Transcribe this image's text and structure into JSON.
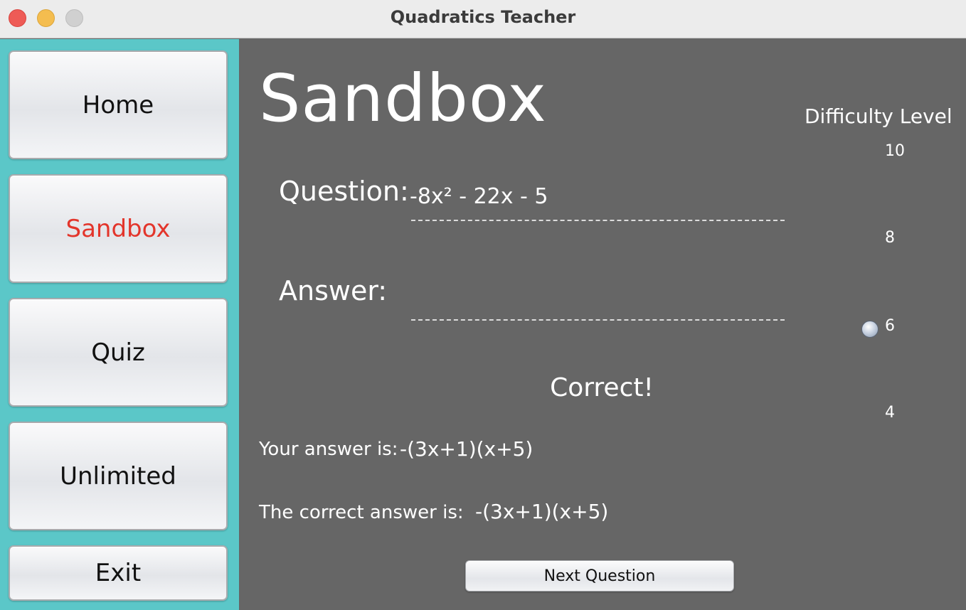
{
  "window": {
    "title": "Quadratics Teacher"
  },
  "sidebar": {
    "items": [
      {
        "label": "Home",
        "active": false
      },
      {
        "label": "Sandbox",
        "active": true
      },
      {
        "label": "Quiz",
        "active": false
      },
      {
        "label": "Unlimited",
        "active": false
      },
      {
        "label": "Exit",
        "active": false
      }
    ],
    "active_color": "#e3352b",
    "background": "#5bc7c8"
  },
  "main": {
    "page_title": "Sandbox",
    "question_label": "Question:",
    "question_text": "-8x² - 22x - 5",
    "answer_label": "Answer:",
    "answer_value": "",
    "result": "Correct!",
    "your_answer_label": "Your answer is:",
    "your_answer_value": "-(3x+1)(x+5)",
    "correct_answer_label": "The correct answer is:",
    "correct_answer_value": "-(3x+1)(x+5)",
    "next_button": "Next Question"
  },
  "difficulty": {
    "label": "Difficulty Level",
    "ticks": [
      "10",
      "8",
      "6",
      "4"
    ],
    "value": 6,
    "min": 4,
    "max": 10
  }
}
